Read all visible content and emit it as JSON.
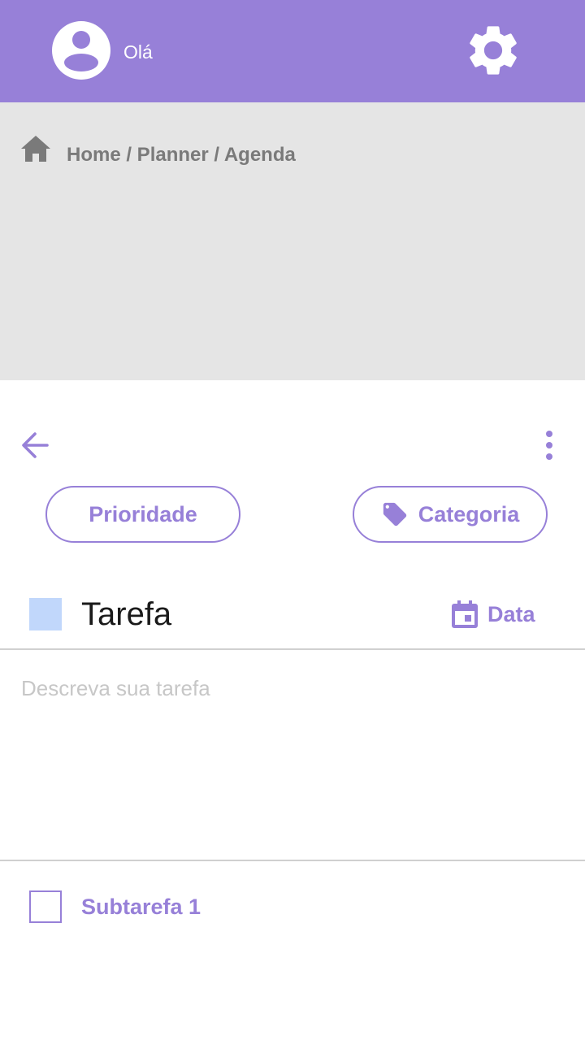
{
  "header": {
    "greeting": "Olá",
    "avatar_icon": "account-circle-icon",
    "settings_icon": "gear-icon",
    "background_color": "#9780d8"
  },
  "breadcrumb": {
    "icon": "home-icon",
    "text": "Home / Planner / Agenda"
  },
  "toolbar": {
    "back_icon": "arrow-left-icon",
    "menu_icon": "more-vertical-icon"
  },
  "filters": {
    "priority_label": "Prioridade",
    "category_label": "Categoria",
    "category_icon": "tag-icon"
  },
  "task": {
    "color": "#c1d7fb",
    "title": "Tarefa",
    "date_label": "Data",
    "date_icon": "calendar-icon",
    "description_placeholder": "Descreva sua tarefa",
    "description_value": ""
  },
  "subtasks": [
    {
      "label": "Subtarefa 1",
      "checked": false
    }
  ],
  "colors": {
    "accent": "#9780d8",
    "panel": "#e5e5e5",
    "placeholder": "#c7c7c7"
  }
}
